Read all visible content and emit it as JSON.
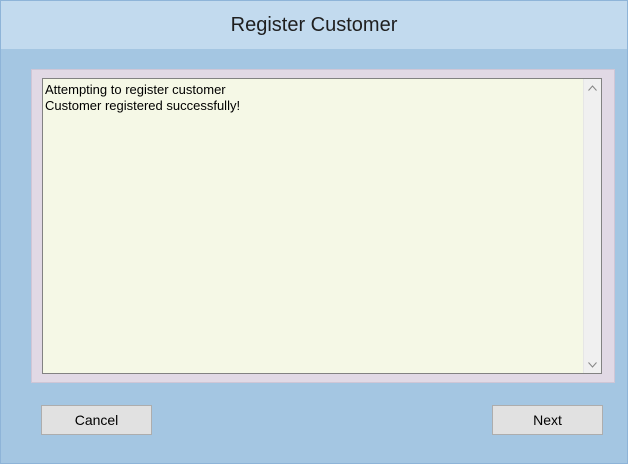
{
  "window": {
    "title": "Register Customer"
  },
  "log": {
    "lines": [
      "Attempting to register customer",
      "Customer registered successfully!"
    ]
  },
  "buttons": {
    "cancel_label": "Cancel",
    "next_label": "Next"
  },
  "icons": {
    "scroll_up": "chevron-up-icon",
    "scroll_down": "chevron-down-icon"
  },
  "colors": {
    "title_bar": "#c2daee",
    "dialog_background": "#a4c6e2",
    "log_background": "#f5f8e6",
    "frame_background": "#e1d9e5"
  }
}
